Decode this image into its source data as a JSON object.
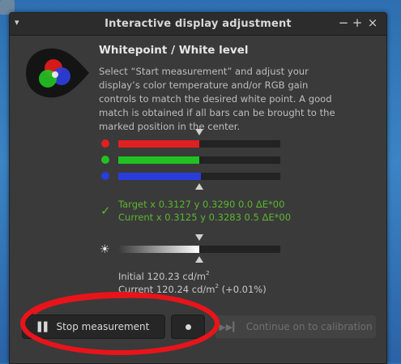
{
  "window": {
    "title": "Interactive display adjustment",
    "controls": {
      "menu": "▾",
      "minimize": "−",
      "maximize": "+",
      "close": "×"
    }
  },
  "panel": {
    "heading": "Whitepoint / White level",
    "description": "Select “Start measurement” and adjust your display’s color temperature and/or RGB gain controls to match the desired white point. A good match is obtained if all bars can be brought to the marked position in the center."
  },
  "rgb_bars": [
    {
      "name": "red",
      "color": "#e02020",
      "level": 0.5
    },
    {
      "name": "green",
      "color": "#22c122",
      "level": 0.5
    },
    {
      "name": "blue",
      "color": "#2a3ddb",
      "level": 0.51
    }
  ],
  "match": {
    "target": "Target x 0.3127 y 0.3290 0.0 ΔE*00",
    "current": "Current x 0.3125 y 0.3283 0.5 ΔE*00"
  },
  "luminance_bar": {
    "level": 0.5
  },
  "luminance": {
    "initial_prefix": "Initial 120.23 cd/m",
    "initial_sup": "2",
    "current_prefix": "Current 120.24 cd/m",
    "current_sup": "2",
    "current_suffix": " (+0.01%)"
  },
  "buttons": {
    "stop": "Stop measurement",
    "continue": "Continue on to calibration"
  },
  "colors": {
    "accent_green": "#5cb531",
    "annotation_red": "#e8141a"
  }
}
